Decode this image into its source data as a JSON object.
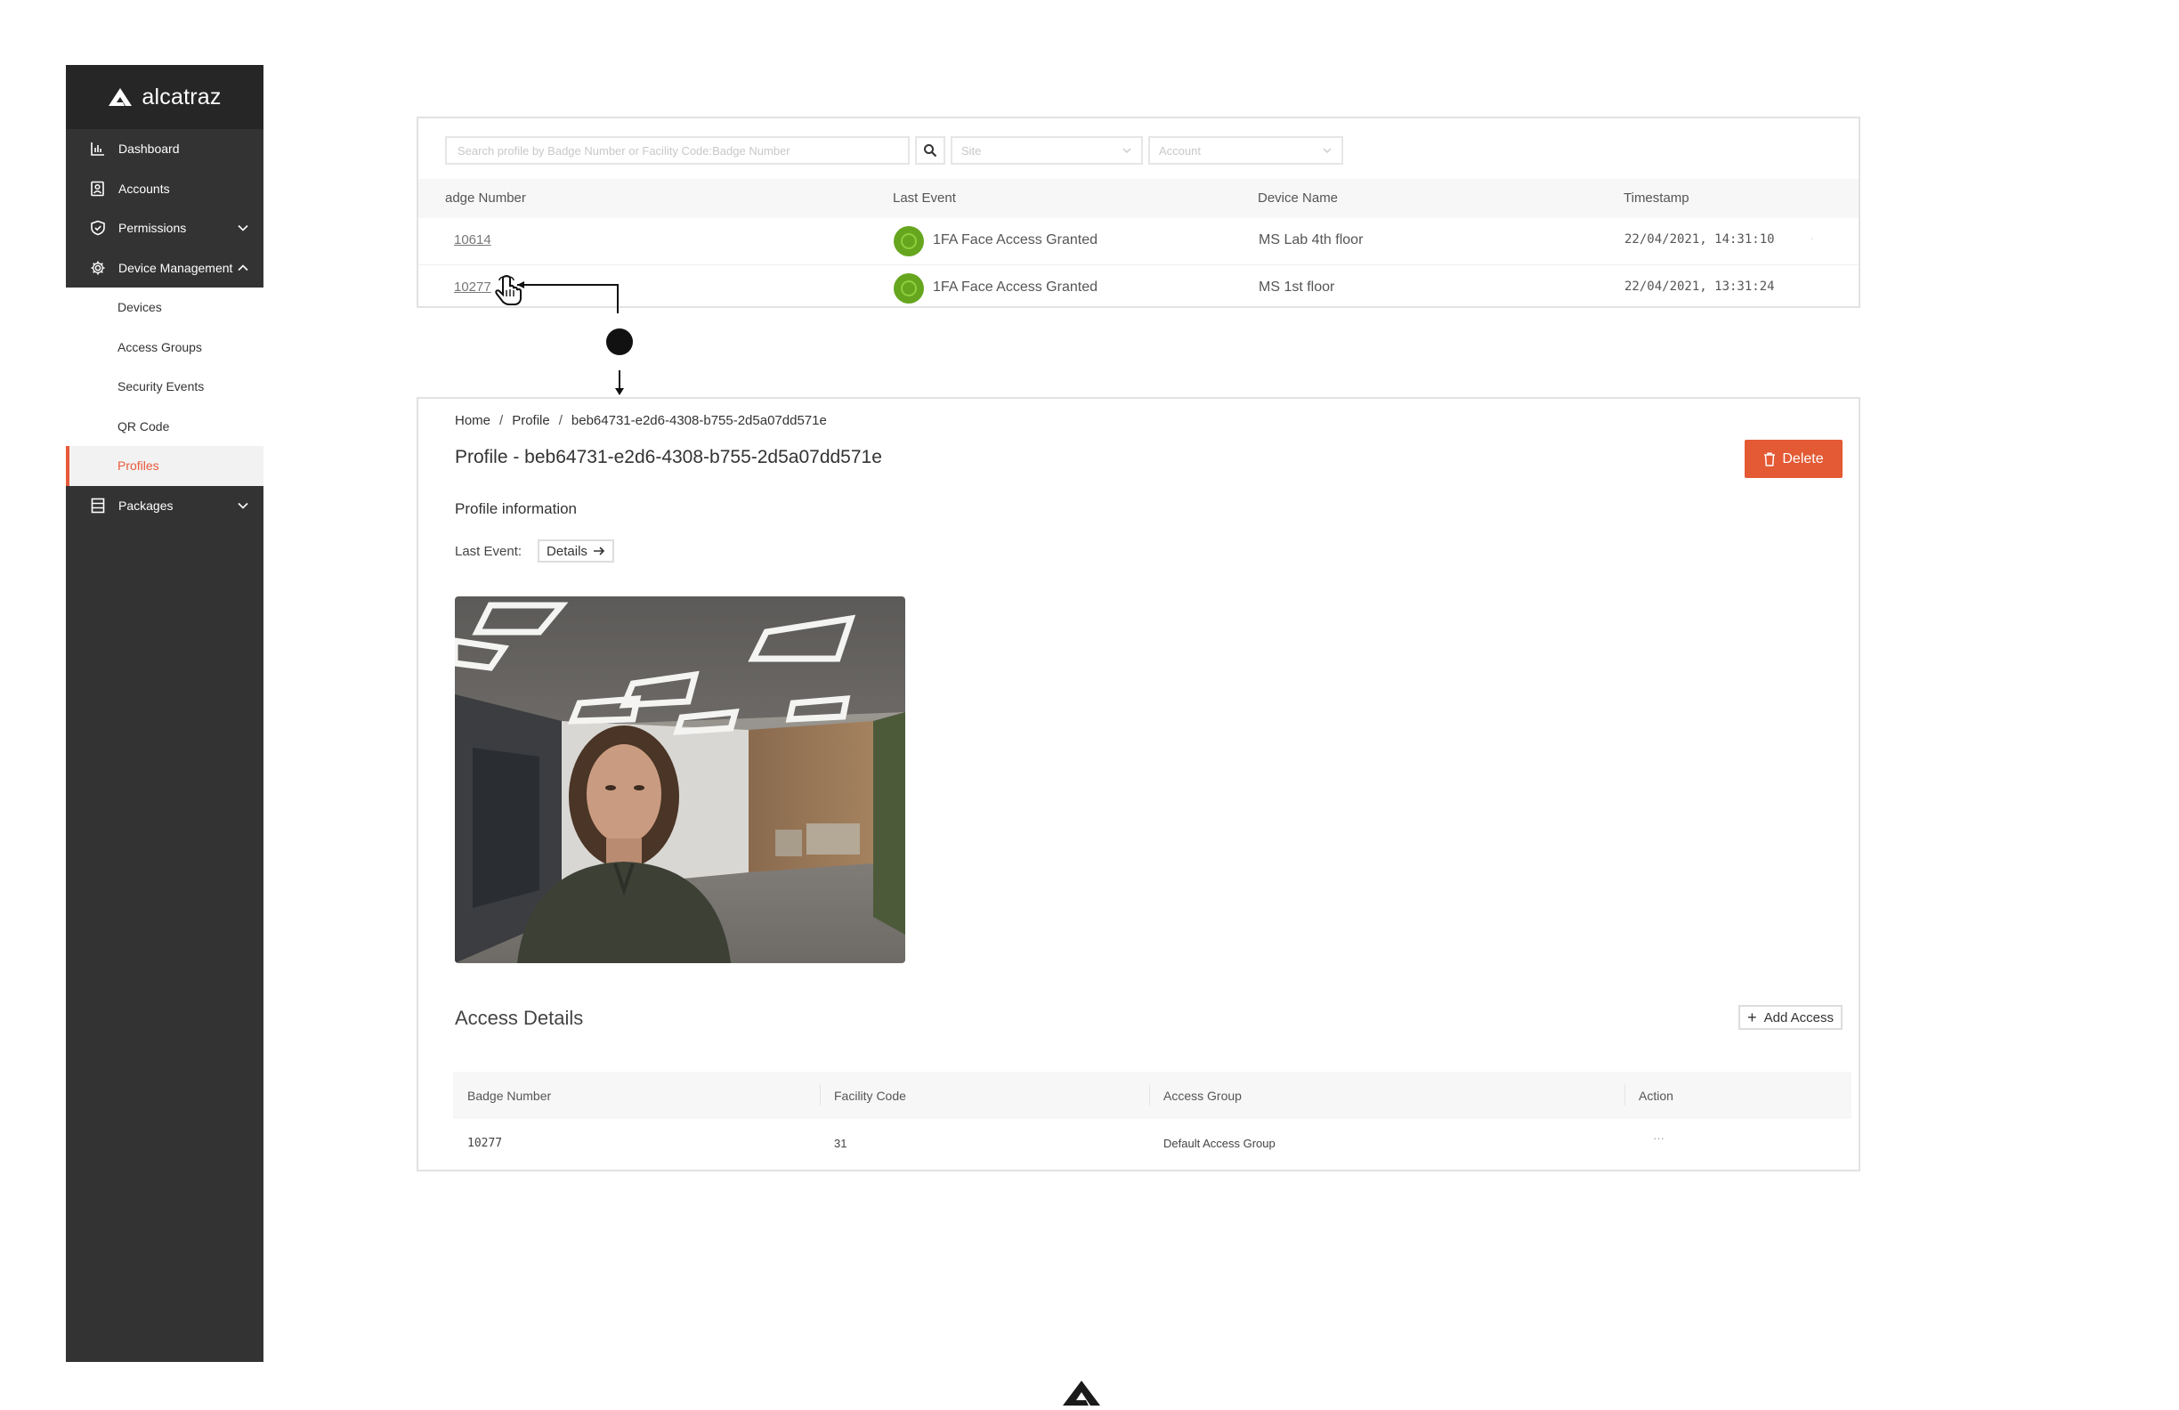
{
  "sidebar": {
    "brand": "alcatraz",
    "items": [
      {
        "label": "Dashboard",
        "icon": "bar-chart-icon"
      },
      {
        "label": "Accounts",
        "icon": "accounts-icon"
      },
      {
        "label": "Permissions",
        "icon": "shield-icon"
      },
      {
        "label": "Device Management",
        "icon": "gear-icon"
      }
    ],
    "sub_items": [
      "Devices",
      "Access Groups",
      "Security Events",
      "QR Code",
      "Profiles"
    ],
    "active_sub_item": "Profiles",
    "packages_label": "Packages"
  },
  "events_table": {
    "search_placeholder": "Search profile by Badge Number or Facility Code:Badge Number",
    "site_placeholder": "Site",
    "account_placeholder": "Account",
    "headers": [
      "adge Number",
      "Last Event",
      "Device Name",
      "Timestamp"
    ],
    "rows": [
      {
        "badge": "10614",
        "event": "1FA Face Access Granted",
        "device": "MS Lab 4th floor",
        "timestamp": "22/04/2021, 14:31:10"
      },
      {
        "badge": "10277",
        "event": "1FA Face Access Granted",
        "device": "MS 1st floor",
        "timestamp": "22/04/2021, 13:31:24"
      }
    ]
  },
  "profile": {
    "breadcrumb": [
      "Home",
      "Profile",
      "beb64731-e2d6-4308-b755-2d5a07dd571e"
    ],
    "title": "Profile - beb64731-e2d6-4308-b755-2d5a07dd571e",
    "delete_label": "Delete",
    "info_title": "Profile information",
    "last_event_label": "Last Event:",
    "details_label": "Details",
    "access_title": "Access Details",
    "add_access_label": "Add Access",
    "access_headers": [
      "Badge Number",
      "Facility Code",
      "Access Group",
      "Action"
    ],
    "access_rows": [
      {
        "badge": "10277",
        "facility": "31",
        "group": "Default Access Group",
        "action": "···"
      }
    ]
  },
  "colors": {
    "sidebar_bg": "#333333",
    "sidebar_header": "#262626",
    "accent": "#e85a3a",
    "delete_button": "#e35a34",
    "status_green": "#66a61e"
  }
}
